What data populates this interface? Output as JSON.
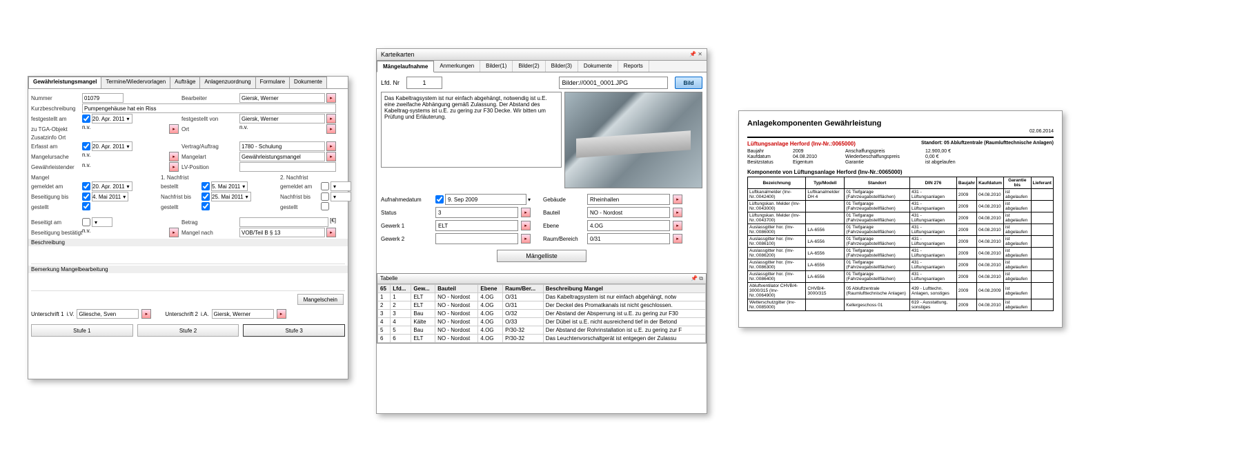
{
  "panel1": {
    "tabs": [
      "Gewährleistungsmangel",
      "Termine/Wiedervorlagen",
      "Aufträge",
      "Anlagenzuordnung",
      "Formulare",
      "Dokumente"
    ],
    "active_tab": 0,
    "labels": {
      "nummer": "Nummer",
      "kurzbeschreibung": "Kurzbeschreibung",
      "festgestellt_am": "festgestellt am",
      "zu_tga": "zu TGA-Objekt",
      "zusatzinfo": "Zusatzinfo Ort",
      "erfasst_am": "Erfasst am",
      "mangelursache": "Mangelursache",
      "gewaehrleistender": "Gewährleistender",
      "mangel": "Mangel",
      "gemeldet_am": "gemeldet am",
      "bestellt": "bestellt",
      "beseitigung_bis": "Beseitigung bis",
      "gestellt": "gestellt",
      "beseitigt_am": "Beseitigt am",
      "beseitigung_bestatigt": "Beseitigung bestätigt",
      "beschreibung": "Beschreibung",
      "bemerkung": "Bemerkung Mangelbearbeitung",
      "unterschrift1": "Unterschrift 1",
      "unterschrift2": "Unterschrift 2",
      "bearbeiter": "Bearbeiter",
      "festgestellt_von": "festgestellt von",
      "ort": "Ort",
      "vertrag": "Vertrag/Auftrag",
      "mangelart": "Mangelart",
      "lvposition": "LV-Position",
      "nachfrist1": "1. Nachfrist",
      "nachfrist2": "2. Nachfrist",
      "nachfrist_bis": "Nachfrist bis",
      "betrag": "Betrag",
      "mangel_nach": "Mangel nach",
      "stufe1": "Stufe 1",
      "stufe2": "Stufe 2",
      "stufe3": "Stufe 3",
      "mangelschein": "Mangelschein",
      "iv": "i.V.",
      "ia": "i.A."
    },
    "values": {
      "nummer": "01079",
      "kurzbeschreibung": "Pumpengehäuse hat ein Riss",
      "festgestellt_am": "20. Apr. 2011",
      "zu_tga": "n.v.",
      "erfasst_am": "20. Apr. 2011",
      "mangelursache": "n.v.",
      "gewaehrleistender": "n.v.",
      "gemeldet_am": "20. Apr. 2011",
      "gestellt_am": "5. Mai 2011",
      "gemeldet_am2": "",
      "beseitigung_bis": "4. Mai 2011",
      "nachfrist_bis": "25. Mai 2011",
      "nachfrist_bis2": "",
      "beseitigung_bestatigt": "n.v.",
      "bearbeiter": "Giersk, Werner",
      "festgestellt_von": "Giersk, Werner",
      "ort": "n.v.",
      "vertrag": "1780 - Schulung",
      "mangelart": "Gewährleistungsmangel",
      "mangel_nach": "VOB/Teil B § 13",
      "betrag_sfx": "[€]",
      "unterschrift1": "Gliesche, Sven",
      "unterschrift2": "Giersk, Werner"
    }
  },
  "panel2": {
    "title": "Karteikarten",
    "tabs": [
      "Mängelaufnahme",
      "Anmerkungen",
      "Bilder(1)",
      "Bilder(2)",
      "Bilder(3)",
      "Dokumente",
      "Reports"
    ],
    "active_tab": 0,
    "lfd_label": "Lfd. Nr",
    "lfd_value": "1",
    "img_path": "Bilder://0001_0001.JPG",
    "bild_btn": "Bild",
    "description": "Das Kabeltragsystem ist nur einfach abgehängt, notwendig ist u.E. eine zweifache Abhängung gemäß Zulassung. Der Abstand des Kabeltrag-systems ist u.E. zu gering zur F30 Decke. Wir bitten um Prüfung und Erläuterung.",
    "meta": {
      "aufnahmedatum_l": "Aufnahmedatum",
      "aufnahmedatum_v": "9. Sep 2009",
      "status_l": "Status",
      "status_v": "3",
      "gewerk1_l": "Gewerk 1",
      "gewerk1_v": "ELT",
      "gewerk2_l": "Gewerk 2",
      "gewerk2_v": "",
      "gebaude_l": "Gebäude",
      "gebaude_v": "Rheinhallen",
      "bauteil_l": "Bauteil",
      "bauteil_v": "NO - Nordost",
      "ebene_l": "Ebene",
      "ebene_v": "4.OG",
      "raum_l": "Raum/Bereich",
      "raum_v": "0/31"
    },
    "mangelliste": "Mängelliste",
    "tabelle_label": "Tabelle",
    "tabelle_count": "65",
    "table_cols": [
      "",
      "Lfd...",
      "Gew...",
      "Bauteil",
      "Ebene",
      "Raum/Ber...",
      "Beschreibung Mangel"
    ],
    "table_rows": [
      [
        "1",
        "1",
        "ELT",
        "NO - Nordost",
        "4.OG",
        "O/31",
        "Das Kabeltragsystem ist nur einfach abgehängt, notw"
      ],
      [
        "2",
        "2",
        "ELT",
        "NO - Nordost",
        "4.OG",
        "O/31",
        "Der Deckel des Promatkanals ist nicht geschlossen."
      ],
      [
        "3",
        "3",
        "Bau",
        "NO - Nordost",
        "4.OG",
        "O/32",
        "Der Abstand der Absperrung ist u.E. zu gering zur F30"
      ],
      [
        "4",
        "4",
        "Kälte",
        "NO - Nordost",
        "4.OG",
        "O/33",
        "Der Dübel ist u.E. nicht ausreichend tief in der Betond"
      ],
      [
        "5",
        "5",
        "Bau",
        "NO - Nordost",
        "4.OG",
        "P/30-32",
        "Der Abstand der Rohrinstallation ist u.E. zu gering zur F"
      ],
      [
        "6",
        "6",
        "ELT",
        "NO - Nordost",
        "4.OG",
        "P/30-32",
        "Das Leuchtenvorschaltgerät ist entgegen der Zulassu"
      ]
    ]
  },
  "panel3": {
    "title": "Anlagekomponenten Gewährleistung",
    "date": "02.06.2014",
    "red": "Lüftungsanlage Herford (Inv-Nr.:0065000)",
    "standort": "Standort: 05 Abluftzentrale (Raumlufttechnische Anlagen)",
    "info_labels": {
      "baujahr": "Baujahr",
      "kaufdatum": "Kaufdatum",
      "besitzstatus": "Besitzstatus",
      "anschaffungspreis": "Anschaffungspreis",
      "wiederbeschaffungspreis": "Wiederbeschaffungspreis",
      "garantie": "Garantie"
    },
    "info_values": {
      "baujahr": "2009",
      "kaufdatum": "04.08.2010",
      "besitzstatus": "Eigentum",
      "anschaffungspreis": "12.900,00 €",
      "wiederbeschaffungspreis": "0,00 €",
      "garantie": "ist abgelaufen"
    },
    "subheading": "Komponente von Lüftungsanlage Herford (Inv-Nr.:0065000)",
    "cols": [
      "Bezeichnung",
      "Typ/Modell",
      "Standort",
      "DIN 276",
      "Baujahr",
      "Kaufdatum",
      "Garantie bis",
      "Lieferant"
    ],
    "rows": [
      [
        "Luftkanalmelder (Inv-Nr.:0042400)",
        "Luftkanalmelder DH 4",
        "01 Tiefgarage (Fahrzeugabstellflächen)",
        "431 - Lüftungsanlagen",
        "2009",
        "04.08.2010",
        "ist abgelaufen",
        ""
      ],
      [
        "Lüftungskan. Melder (Inv-Nr.:0043000)",
        "",
        "01 Tiefgarage (Fahrzeugabstellflächen)",
        "431 - Lüftungsanlagen",
        "2009",
        "04.08.2010",
        "ist abgelaufen",
        ""
      ],
      [
        "Lüftungskan. Melder (Inv-Nr.:0043700)",
        "",
        "01 Tiefgarage (Fahrzeugabstellflächen)",
        "431 - Lüftungsanlagen",
        "2009",
        "04.08.2010",
        "ist abgelaufen",
        ""
      ],
      [
        "Auslassgitter hor. (Inv-Nr.:0086000)",
        "LA-6556",
        "01 Tiefgarage (Fahrzeugabstellflächen)",
        "431 - Lüftungsanlagen",
        "2009",
        "04.08.2010",
        "ist abgelaufen",
        ""
      ],
      [
        "Auslassgitter hor. (Inv-Nr.:0086100)",
        "LA-6556",
        "01 Tiefgarage (Fahrzeugabstellflächen)",
        "431 - Lüftungsanlagen",
        "2009",
        "04.08.2010",
        "ist abgelaufen",
        ""
      ],
      [
        "Auslassgitter hor. (Inv-Nr.:0086200)",
        "LA-6556",
        "01 Tiefgarage (Fahrzeugabstellflächen)",
        "431 - Lüftungsanlagen",
        "2009",
        "04.08.2010",
        "ist abgelaufen",
        ""
      ],
      [
        "Auslassgitter hor. (Inv-Nr.:0086300)",
        "LA-6556",
        "01 Tiefgarage (Fahrzeugabstellflächen)",
        "431 - Lüftungsanlagen",
        "2009",
        "04.08.2010",
        "ist abgelaufen",
        ""
      ],
      [
        "Auslassgitter hor. (Inv-Nr.:0086400)",
        "LA-6556",
        "01 Tiefgarage (Fahrzeugabstellflächen)",
        "431 - Lüftungsanlagen",
        "2009",
        "04.08.2010",
        "ist abgelaufen",
        ""
      ],
      [
        "Abluftventilator CHVB/4-3000/315 (Inv-Nr.:0064900)",
        "CHVB/4-3000/315",
        "05 Abluftzentrale (Raumlufttechnische Anlagen)",
        "439 - Lufttechn. Anlagen, sonstiges",
        "2009",
        "04.08.2009",
        "ist abgelaufen",
        ""
      ],
      [
        "Wetterschutzgitter (Inv-Nr.:0085000)",
        "",
        "Kellergeschoss 01",
        "619 - Ausstattung, sonstiges",
        "2009",
        "04.08.2010",
        "ist abgelaufen",
        ""
      ]
    ]
  }
}
